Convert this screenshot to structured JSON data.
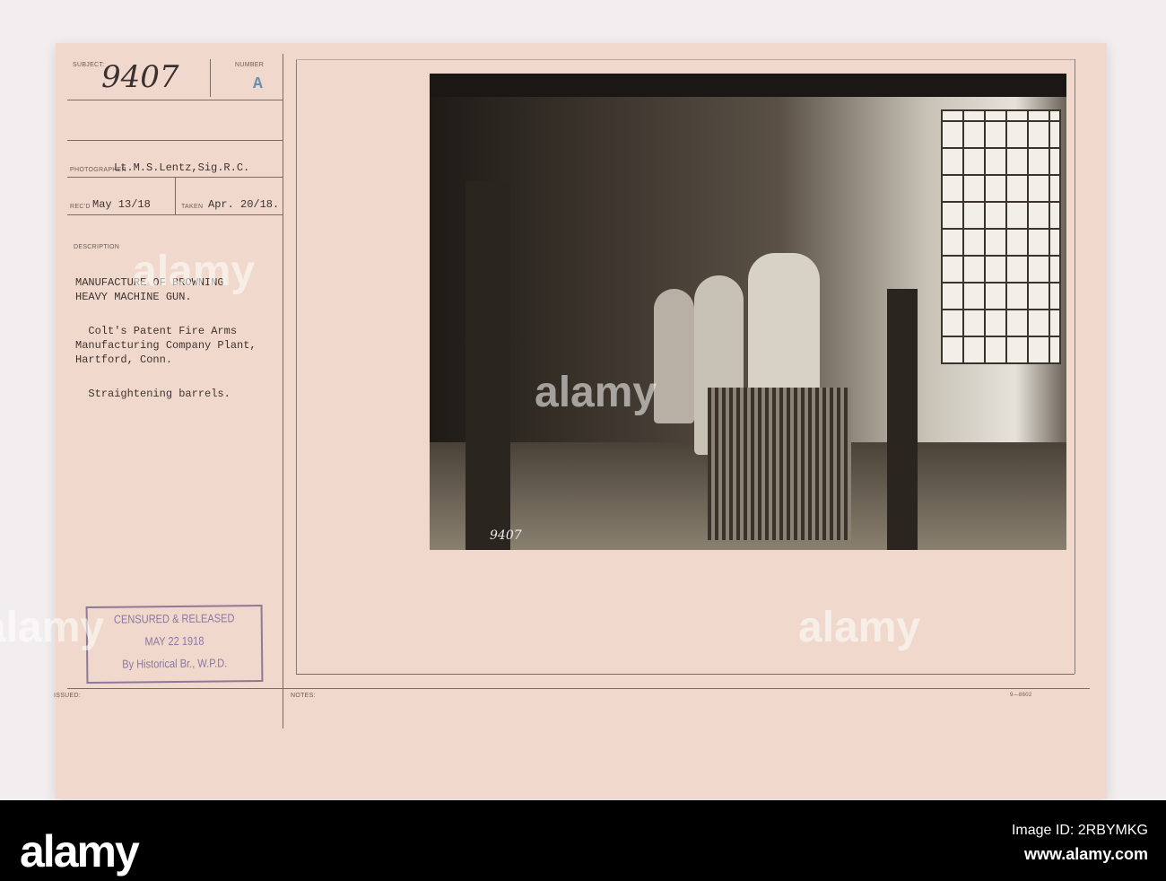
{
  "card": {
    "subject_label": "SUBJECT:",
    "subject_value": "9407",
    "number_label": "NUMBER",
    "number_value": "A",
    "photographer_label": "PHOTOGRAPHER",
    "photographer_value": "Lt.M.S.Lentz,Sig.R.C.",
    "recd_label": "REC'D",
    "recd_value": "May 13/18",
    "taken_label": "TAKEN",
    "taken_value": "Apr. 20/18.",
    "description_label": "DESCRIPTION",
    "description_lines": [
      "MANUFACTURE OF BROWNING",
      "HEAVY MACHINE GUN.",
      "  Colt's Patent Fire Arms",
      "Manufacturing Company Plant,",
      "Hartford, Conn.",
      "  Straightening barrels."
    ],
    "issued_label": "ISSUED:",
    "notes_label": "NOTES:",
    "form_number": "9—8602",
    "photo_marking": "9407"
  },
  "stamp": {
    "line1": "CENSURED & RELEASED",
    "line2": "MAY 22 1918",
    "line3": "By Historical Br., W.P.D."
  },
  "footer": {
    "logo": "alamy",
    "image_id": "Image ID: 2RBYMKG",
    "url": "www.alamy.com"
  },
  "watermark": "alamy"
}
